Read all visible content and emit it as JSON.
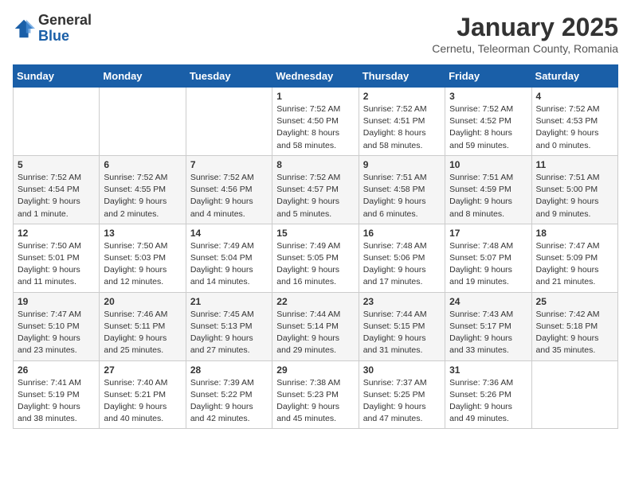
{
  "header": {
    "logo_general": "General",
    "logo_blue": "Blue",
    "month_title": "January 2025",
    "location": "Cernetu, Teleorman County, Romania"
  },
  "days_of_week": [
    "Sunday",
    "Monday",
    "Tuesday",
    "Wednesday",
    "Thursday",
    "Friday",
    "Saturday"
  ],
  "weeks": [
    [
      {
        "day": "",
        "info": ""
      },
      {
        "day": "",
        "info": ""
      },
      {
        "day": "",
        "info": ""
      },
      {
        "day": "1",
        "info": "Sunrise: 7:52 AM\nSunset: 4:50 PM\nDaylight: 8 hours and 58 minutes."
      },
      {
        "day": "2",
        "info": "Sunrise: 7:52 AM\nSunset: 4:51 PM\nDaylight: 8 hours and 58 minutes."
      },
      {
        "day": "3",
        "info": "Sunrise: 7:52 AM\nSunset: 4:52 PM\nDaylight: 8 hours and 59 minutes."
      },
      {
        "day": "4",
        "info": "Sunrise: 7:52 AM\nSunset: 4:53 PM\nDaylight: 9 hours and 0 minutes."
      }
    ],
    [
      {
        "day": "5",
        "info": "Sunrise: 7:52 AM\nSunset: 4:54 PM\nDaylight: 9 hours and 1 minute."
      },
      {
        "day": "6",
        "info": "Sunrise: 7:52 AM\nSunset: 4:55 PM\nDaylight: 9 hours and 2 minutes."
      },
      {
        "day": "7",
        "info": "Sunrise: 7:52 AM\nSunset: 4:56 PM\nDaylight: 9 hours and 4 minutes."
      },
      {
        "day": "8",
        "info": "Sunrise: 7:52 AM\nSunset: 4:57 PM\nDaylight: 9 hours and 5 minutes."
      },
      {
        "day": "9",
        "info": "Sunrise: 7:51 AM\nSunset: 4:58 PM\nDaylight: 9 hours and 6 minutes."
      },
      {
        "day": "10",
        "info": "Sunrise: 7:51 AM\nSunset: 4:59 PM\nDaylight: 9 hours and 8 minutes."
      },
      {
        "day": "11",
        "info": "Sunrise: 7:51 AM\nSunset: 5:00 PM\nDaylight: 9 hours and 9 minutes."
      }
    ],
    [
      {
        "day": "12",
        "info": "Sunrise: 7:50 AM\nSunset: 5:01 PM\nDaylight: 9 hours and 11 minutes."
      },
      {
        "day": "13",
        "info": "Sunrise: 7:50 AM\nSunset: 5:03 PM\nDaylight: 9 hours and 12 minutes."
      },
      {
        "day": "14",
        "info": "Sunrise: 7:49 AM\nSunset: 5:04 PM\nDaylight: 9 hours and 14 minutes."
      },
      {
        "day": "15",
        "info": "Sunrise: 7:49 AM\nSunset: 5:05 PM\nDaylight: 9 hours and 16 minutes."
      },
      {
        "day": "16",
        "info": "Sunrise: 7:48 AM\nSunset: 5:06 PM\nDaylight: 9 hours and 17 minutes."
      },
      {
        "day": "17",
        "info": "Sunrise: 7:48 AM\nSunset: 5:07 PM\nDaylight: 9 hours and 19 minutes."
      },
      {
        "day": "18",
        "info": "Sunrise: 7:47 AM\nSunset: 5:09 PM\nDaylight: 9 hours and 21 minutes."
      }
    ],
    [
      {
        "day": "19",
        "info": "Sunrise: 7:47 AM\nSunset: 5:10 PM\nDaylight: 9 hours and 23 minutes."
      },
      {
        "day": "20",
        "info": "Sunrise: 7:46 AM\nSunset: 5:11 PM\nDaylight: 9 hours and 25 minutes."
      },
      {
        "day": "21",
        "info": "Sunrise: 7:45 AM\nSunset: 5:13 PM\nDaylight: 9 hours and 27 minutes."
      },
      {
        "day": "22",
        "info": "Sunrise: 7:44 AM\nSunset: 5:14 PM\nDaylight: 9 hours and 29 minutes."
      },
      {
        "day": "23",
        "info": "Sunrise: 7:44 AM\nSunset: 5:15 PM\nDaylight: 9 hours and 31 minutes."
      },
      {
        "day": "24",
        "info": "Sunrise: 7:43 AM\nSunset: 5:17 PM\nDaylight: 9 hours and 33 minutes."
      },
      {
        "day": "25",
        "info": "Sunrise: 7:42 AM\nSunset: 5:18 PM\nDaylight: 9 hours and 35 minutes."
      }
    ],
    [
      {
        "day": "26",
        "info": "Sunrise: 7:41 AM\nSunset: 5:19 PM\nDaylight: 9 hours and 38 minutes."
      },
      {
        "day": "27",
        "info": "Sunrise: 7:40 AM\nSunset: 5:21 PM\nDaylight: 9 hours and 40 minutes."
      },
      {
        "day": "28",
        "info": "Sunrise: 7:39 AM\nSunset: 5:22 PM\nDaylight: 9 hours and 42 minutes."
      },
      {
        "day": "29",
        "info": "Sunrise: 7:38 AM\nSunset: 5:23 PM\nDaylight: 9 hours and 45 minutes."
      },
      {
        "day": "30",
        "info": "Sunrise: 7:37 AM\nSunset: 5:25 PM\nDaylight: 9 hours and 47 minutes."
      },
      {
        "day": "31",
        "info": "Sunrise: 7:36 AM\nSunset: 5:26 PM\nDaylight: 9 hours and 49 minutes."
      },
      {
        "day": "",
        "info": ""
      }
    ]
  ]
}
